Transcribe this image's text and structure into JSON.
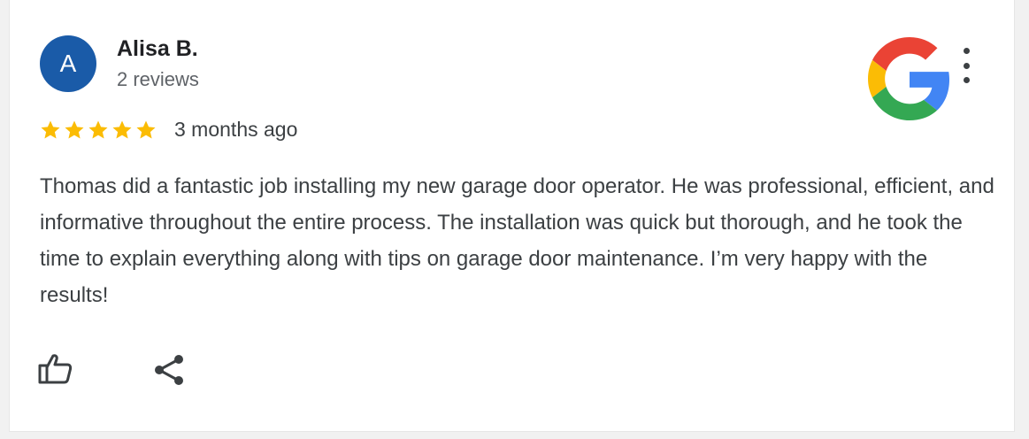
{
  "review": {
    "avatar_letter": "A",
    "avatar_color": "#1a5ba8",
    "reviewer_name": "Alisa B.",
    "reviewer_stats": "2 reviews",
    "rating": 5,
    "rating_max": 5,
    "star_color": "#fbbc04",
    "date": "3 months ago",
    "text": "Thomas did a fantastic job installing my new garage door operator. He was professional, efficient, and informative throughout the entire process. The installation was quick but thorough, and he took the time to explain everything along with tips on garage door maintenance. I’m very happy with the results!"
  },
  "icons": {
    "source_logo": "google-g-icon",
    "menu": "more-vert-icon",
    "like": "thumbs-up-icon",
    "share": "share-icon"
  },
  "brand_colors": {
    "blue": "#4285f4",
    "red": "#ea4335",
    "yellow": "#fbbc05",
    "green": "#34a853"
  }
}
